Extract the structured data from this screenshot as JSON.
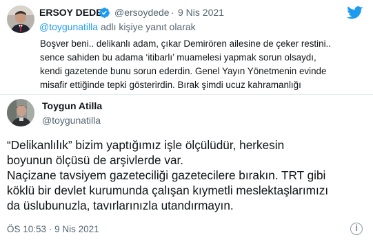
{
  "quoted_tweet": {
    "author_name": "ERSOY DEDE",
    "handle": "@ersoydede",
    "separator": "·",
    "date": "9 Nis 2021",
    "reply_prefix": "@toygunatilla",
    "reply_suffix": "adlı kişiye yanıt olarak",
    "body_lines": [
      "Boşver beni.. delikanlı adam, çıkar Demirören ailesine de çeker restini..",
      "sence sahiden bu adama ‘itibarlı’ muamelesi yapmak sorun olsaydı,",
      "kendi gazetende bunu sorun ederdin. Genel Yayın Yönetmenin evinde",
      "misafir ettiğinde tepki gösterirdin. Bırak şimdi ucuz kahramanlığı"
    ]
  },
  "main_tweet": {
    "author_name": "Toygun Atilla",
    "handle": "@toygunatilla",
    "body_lines": [
      "“Delikanlılık” bizim yaptığımız işle ölçülüdür, herkesin",
      "boyunun ölçüsü de arşivlerde var.",
      "Naçizane tavsiyem gazeteciliği gazetecilere bırakın. TRT gibi",
      "köklü bir devlet kurumunda çalışan kıymetli meslektaşlarımızı",
      "da üslubunuzla, tavırlarınızla utandırmayın."
    ],
    "timestamp": "ÖS 10:53",
    "separator": "·",
    "date": "9 Nis 2021",
    "info_glyph": "i"
  },
  "icons": {
    "verified": "verified-badge-icon",
    "twitter": "twitter-bird-icon",
    "info": "info-icon"
  },
  "colors": {
    "accent": "#1d9bf0",
    "muted": "#536471",
    "text": "#0f1419"
  }
}
